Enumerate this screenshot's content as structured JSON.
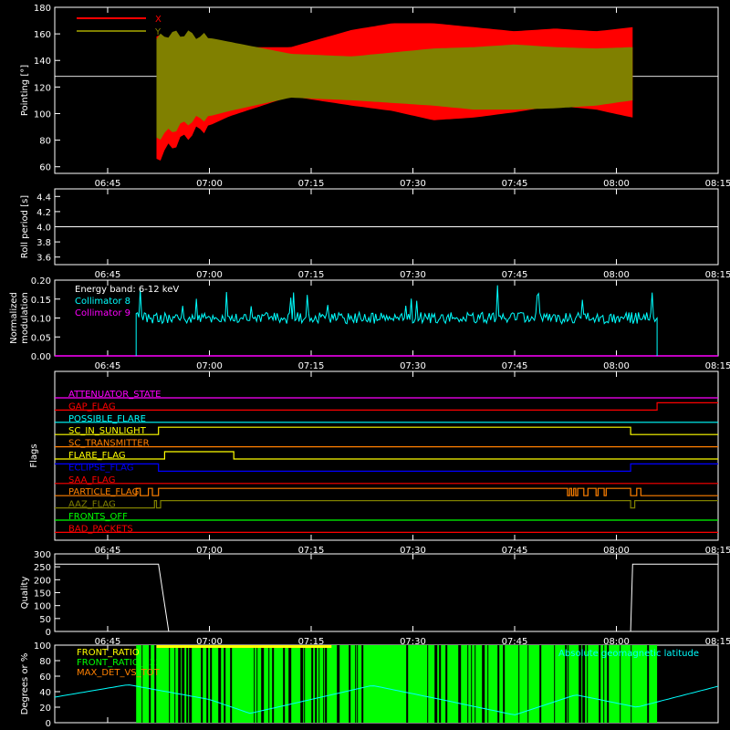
{
  "chart_data": [
    {
      "type": "area",
      "ylabel": "Pointing [°]",
      "ylim": [
        55,
        180
      ],
      "yticks": [
        60,
        80,
        100,
        120,
        140,
        160,
        180
      ],
      "legend_placement": "top-left",
      "series": [
        {
          "name": "X",
          "color": "#ff0000",
          "x": [
            6.87,
            6.9,
            6.95,
            7.05,
            7.2,
            7.35,
            7.45,
            7.55,
            7.65,
            7.75,
            7.85,
            7.95,
            8.04
          ],
          "upper": [
            158,
            150,
            156,
            150,
            150,
            163,
            168,
            168,
            165,
            162,
            164,
            162,
            165
          ],
          "lower": [
            66,
            74,
            84,
            98,
            113,
            106,
            102,
            95,
            97,
            101,
            106,
            103,
            97
          ]
        },
        {
          "name": "Y",
          "color": "#808000",
          "x": [
            6.87,
            6.9,
            6.95,
            7.05,
            7.2,
            7.35,
            7.45,
            7.55,
            7.65,
            7.75,
            7.85,
            7.95,
            8.04
          ],
          "upper": [
            156,
            160,
            160,
            154,
            145,
            143,
            146,
            149,
            150,
            152,
            150,
            149,
            150
          ],
          "lower": [
            82,
            86,
            94,
            102,
            112,
            110,
            108,
            106,
            103,
            103,
            104,
            106,
            110
          ]
        }
      ],
      "reference_line": 128
    },
    {
      "type": "line",
      "ylabel": "Roll period [s]",
      "ylim": [
        3.5,
        4.5
      ],
      "yticks": [
        "3.6",
        "3.8",
        "4.0",
        "4.2",
        "4.4"
      ],
      "series": [
        {
          "x": [
            6.62,
            8.25
          ],
          "values": [
            4.0,
            4.0
          ]
        }
      ]
    },
    {
      "type": "line",
      "ylabel": "Normalized modulation",
      "ylim": [
        0.0,
        0.2
      ],
      "yticks": [
        "0.00",
        "0.05",
        "0.10",
        "0.15",
        "0.20"
      ],
      "legend_placement": "top-left",
      "annotation": "Energy band: 6-12 keV",
      "series": [
        {
          "name": "Collimator 8",
          "color": "#00ffff",
          "x_start": 6.82,
          "x_end": 8.1,
          "mean": 0.1,
          "spread": 0.015
        },
        {
          "name": "Collimator 9",
          "color": "#ff00ff",
          "x": [
            6.62,
            8.25
          ],
          "values": [
            0,
            0
          ]
        }
      ]
    },
    {
      "type": "step",
      "ylabel": "Flags",
      "series": [
        {
          "name": "ATTENUATOR_STATE",
          "color": "#ff00ff",
          "x": [
            6.62
          ],
          "values": [
            0
          ]
        },
        {
          "name": "GAP_FLAG",
          "color": "#ff0000",
          "x": [
            6.62,
            8.1
          ],
          "values": [
            0,
            1
          ]
        },
        {
          "name": "POSSIBLE_FLARE",
          "color": "#00ffff",
          "x": [
            6.62
          ],
          "values": [
            0
          ]
        },
        {
          "name": "SC_IN_SUNLIGHT",
          "color": "#ffff00",
          "x": [
            6.62,
            6.875,
            8.035
          ],
          "values": [
            0,
            1,
            0
          ]
        },
        {
          "name": "SC_TRANSMITTER",
          "color": "#ff7f00",
          "x": [
            6.62
          ],
          "values": [
            0
          ]
        },
        {
          "name": "FLARE_FLAG",
          "color": "#ffff00",
          "x": [
            6.62,
            6.89,
            7.06
          ],
          "values": [
            0,
            1,
            0
          ]
        },
        {
          "name": "ECLIPSE_FLAG",
          "color": "#0000ff",
          "x": [
            6.62,
            6.875,
            8.035
          ],
          "values": [
            1,
            0,
            1
          ]
        },
        {
          "name": "SAA_FLAG",
          "color": "#ff0000",
          "x": [
            6.62
          ],
          "values": [
            0
          ]
        },
        {
          "name": "PARTICLE_FLAG",
          "color": "#ff8000",
          "x": [
            6.62,
            6.82,
            6.83,
            6.85,
            6.86,
            6.875,
            7.88,
            7.885,
            7.89,
            7.895,
            7.9,
            7.905,
            7.92,
            7.93,
            7.95,
            7.955,
            7.97,
            7.975,
            8.035,
            8.05,
            8.06
          ],
          "values": [
            0,
            1,
            0,
            1,
            0,
            1,
            0,
            1,
            0,
            1,
            0,
            1,
            0,
            1,
            0,
            1,
            0,
            1,
            0,
            1,
            0
          ]
        },
        {
          "name": "AAZ_FLAG",
          "color": "#808000",
          "x": [
            6.62,
            6.865,
            6.87,
            6.88,
            8.035,
            8.045
          ],
          "values": [
            0,
            1,
            0,
            1,
            0,
            1
          ]
        },
        {
          "name": "FRONTS_OFF",
          "color": "#00ff00",
          "x": [
            6.62
          ],
          "values": [
            0
          ]
        },
        {
          "name": "BAD_PACKETS",
          "color": "#ff0000",
          "x": [
            6.62
          ],
          "values": [
            0
          ]
        }
      ]
    },
    {
      "type": "line",
      "ylabel": "Quality",
      "ylim": [
        0,
        300
      ],
      "yticks": [
        "0",
        "50",
        "100",
        "150",
        "200",
        "250",
        "300"
      ],
      "series": [
        {
          "x": [
            6.62,
            6.875,
            6.9,
            8.035,
            8.04,
            8.25
          ],
          "values": [
            260,
            260,
            0,
            0,
            260,
            260
          ]
        }
      ]
    },
    {
      "type": "bar",
      "ylabel": "Degrees or %",
      "ylim": [
        0,
        100
      ],
      "yticks": [
        "0",
        "20",
        "40",
        "60",
        "80",
        "100"
      ],
      "legend_placement": "top-left",
      "series": [
        {
          "name": "FRONT_RATIO",
          "color": "#ffff00"
        },
        {
          "name": "FRONT_RATIO_1225",
          "color": "#00ff00",
          "x_start": 6.82,
          "x_end": 8.1
        },
        {
          "name": "MAX_DET_VS_TOT",
          "color": "#ff8000"
        },
        {
          "name": "Absolute geomagnetic latitude",
          "color": "#00ffff",
          "x": [
            6.62,
            6.8,
            7.0,
            7.1,
            7.25,
            7.4,
            7.55,
            7.75,
            7.9,
            8.05,
            8.25
          ],
          "values": [
            33,
            49,
            30,
            12,
            30,
            48,
            32,
            10,
            36,
            20,
            47
          ]
        }
      ]
    }
  ],
  "xaxis": {
    "xlim": [
      6.62,
      8.25
    ],
    "ticks": [
      6.75,
      7.0,
      7.25,
      7.5,
      7.75,
      8.0,
      8.25
    ],
    "tick_labels": [
      "06:45",
      "07:00",
      "07:15",
      "07:30",
      "07:45",
      "08:00",
      "08:15"
    ]
  }
}
